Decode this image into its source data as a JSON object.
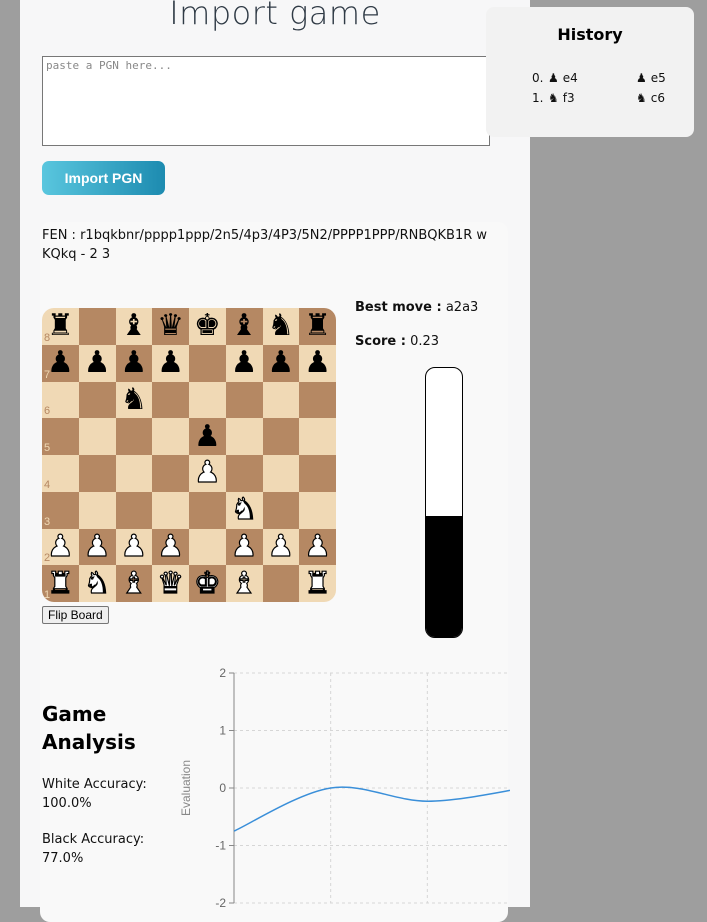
{
  "import": {
    "title": "Import game",
    "pgn_placeholder": "paste a PGN here...",
    "pgn_value": "",
    "button_label": "Import PGN"
  },
  "fen": {
    "label": "FEN :",
    "value": "r1bqkbnr/pppp1ppp/2n5/4p3/4P3/5N2/PPPP1PPP/RNBQKB1R w KQkq - 2 3"
  },
  "board": {
    "flip_label": "Flip Board",
    "rank_labels": [
      "8",
      "7",
      "6",
      "5",
      "4",
      "3",
      "2",
      "1"
    ],
    "rows": [
      [
        "r",
        "",
        "b",
        "q",
        "k",
        "b",
        "n",
        "r"
      ],
      [
        "p",
        "p",
        "p",
        "p",
        "",
        "p",
        "p",
        "p"
      ],
      [
        "",
        "",
        "n",
        "",
        "",
        "",
        "",
        ""
      ],
      [
        "",
        "",
        "",
        "",
        "p",
        "",
        "",
        ""
      ],
      [
        "",
        "",
        "",
        "",
        "P",
        "",
        "",
        ""
      ],
      [
        "",
        "",
        "",
        "",
        "",
        "N",
        "",
        ""
      ],
      [
        "P",
        "P",
        "P",
        "P",
        "",
        "P",
        "P",
        "P"
      ],
      [
        "R",
        "N",
        "B",
        "Q",
        "K",
        "B",
        "",
        "R"
      ]
    ],
    "light_color": "#f0d9b5",
    "dark_color": "#b58863"
  },
  "engine": {
    "best_move_label": "Best move :",
    "best_move": "a2a3",
    "score_label": "Score :",
    "score": "0.23",
    "eval_bar_white_fraction": 0.55
  },
  "analysis": {
    "title": "Game Analysis",
    "white_accuracy_label": "White Accuracy:",
    "white_accuracy": "100.0%",
    "black_accuracy_label": "Black Accuracy:",
    "black_accuracy": "77.0%"
  },
  "history": {
    "title": "History",
    "moves": [
      {
        "num": "0.",
        "white_piece": "pawn-icon",
        "white": "e4",
        "black_piece": "pawn-icon",
        "black": "e5"
      },
      {
        "num": "1.",
        "white_piece": "knight-icon",
        "white": "f3",
        "black_piece": "knight-icon",
        "black": "c6"
      }
    ]
  },
  "chart_data": {
    "type": "line",
    "ylabel": "Evaluation",
    "xlabel": "",
    "ylim": [
      -2,
      2
    ],
    "yticks": [
      2,
      1,
      0,
      -1,
      -2
    ],
    "xlim": [
      0,
      3
    ],
    "grid": true,
    "series": [
      {
        "x": [
          0,
          1,
          2,
          3
        ],
        "values": [
          -0.75,
          0.0,
          -0.23,
          0.0
        ],
        "color": "#3a8fd9"
      }
    ]
  }
}
